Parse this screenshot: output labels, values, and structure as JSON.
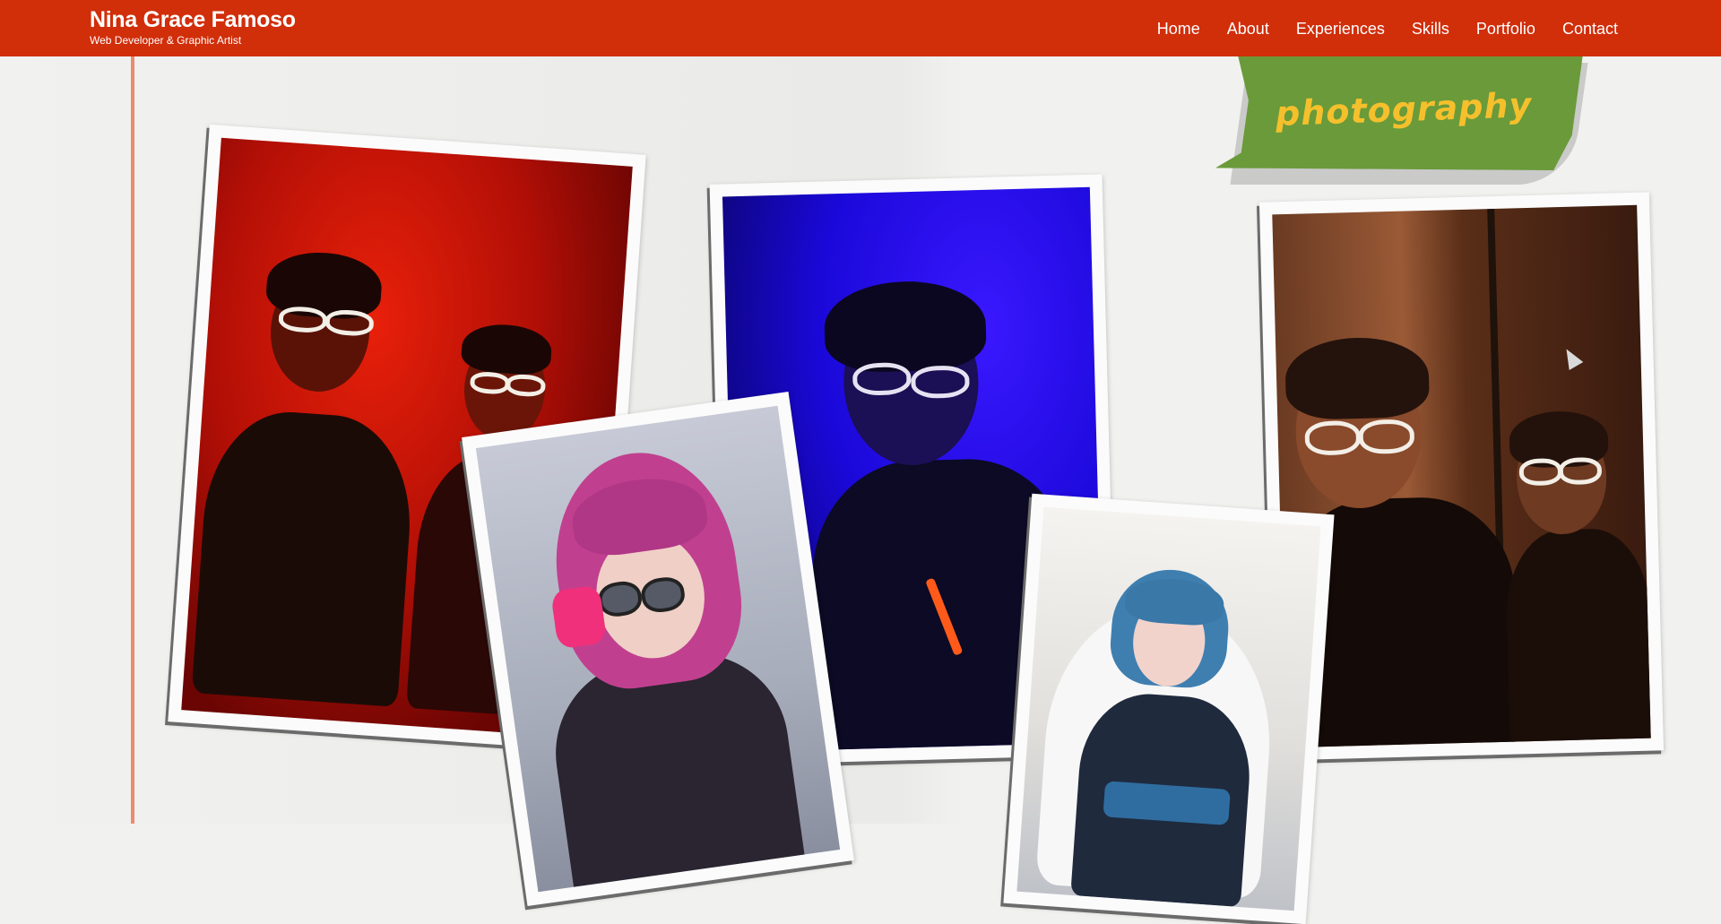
{
  "header": {
    "brand_name": "Nina Grace Famoso",
    "brand_subtitle": "Web Developer & Graphic Artist",
    "nav": [
      "Home",
      "About",
      "Experiences",
      "Skills",
      "Portfolio",
      "Contact"
    ]
  },
  "section": {
    "tag_label": "photography"
  },
  "colors": {
    "header_bg": "#d12e0a",
    "tag_bg": "#6a9a3a",
    "tag_text": "#f5c02c",
    "paper_line": "#a9d8c9",
    "margin_line": "#ec8a72"
  },
  "photos": [
    {
      "name": "red-portrait-photo"
    },
    {
      "name": "blue-portrait-photo"
    },
    {
      "name": "pink-hair-cosplay-photo"
    },
    {
      "name": "blue-hair-cosplay-photo"
    },
    {
      "name": "warm-mirror-portrait-photo"
    }
  ]
}
